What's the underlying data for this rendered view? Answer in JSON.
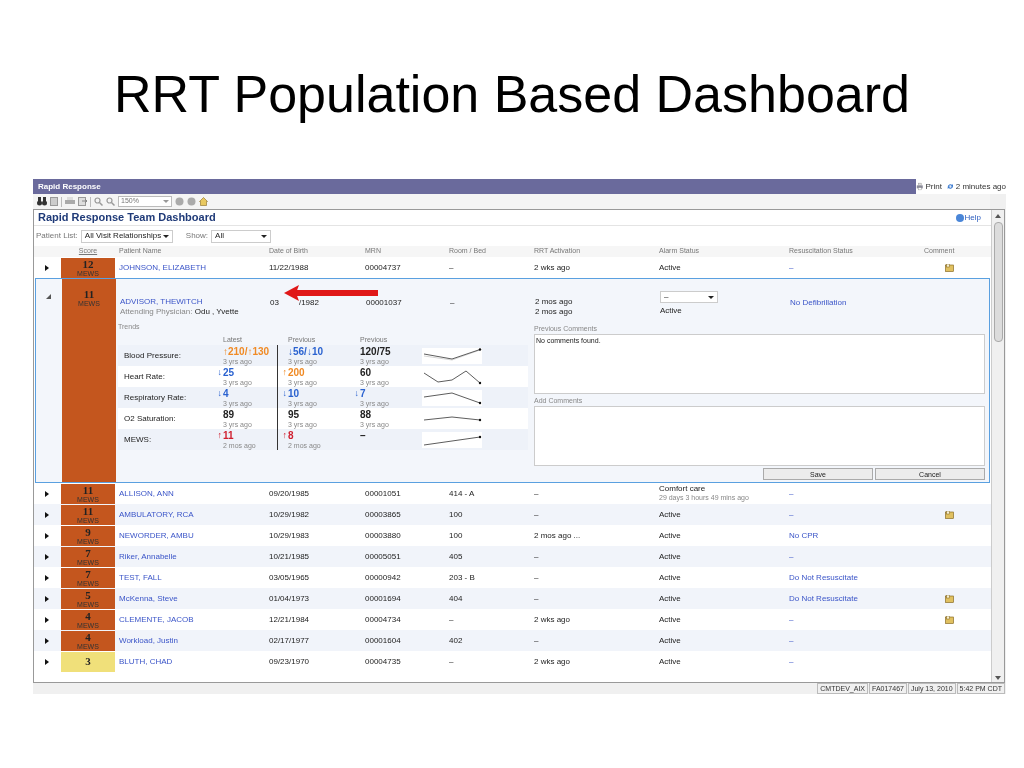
{
  "slide_title": "RRT Population Based Dashboard",
  "window": {
    "title": "Rapid Response",
    "print": "Print",
    "refreshed": "2 minutes ago"
  },
  "toolbar": {
    "zoom": "150%"
  },
  "dashboard": {
    "title": "Rapid Response Team Dashboard",
    "help": "Help"
  },
  "filters": [
    {
      "label": "Patient List:",
      "value": "All Visit Relationships"
    },
    {
      "label": "Show:",
      "value": "All"
    }
  ],
  "table": {
    "columns": [
      "Score",
      "Patient Name",
      "Date of Birth",
      "MRN",
      "Room / Bed",
      "RRT Activation",
      "Alarm Status",
      "Resuscitation Status",
      "Comment"
    ],
    "rows": [
      {
        "expanded": false,
        "score": "12",
        "score_label": "MEWS",
        "color": "#c4561e",
        "name": "JOHNSON, ELIZABETH",
        "dob": "11/22/1988",
        "mrn": "00004737",
        "room": "–",
        "rrt": [
          "2 wks ago"
        ],
        "alarm": "Active",
        "resuscitation": "–",
        "comment": true
      },
      {
        "expanded": true,
        "score": "11",
        "score_label": "MEWS",
        "color": "#c4561e",
        "name": "ADVISOR, THEWITCH",
        "physician_label": "Attending Physician:",
        "physician": "Odu , Yvette",
        "dob_visible": [
          "03",
          "/1982"
        ],
        "mrn": "00001037",
        "room": "–",
        "rrt": [
          "2 mos ago",
          "2 mos ago"
        ],
        "alarm_select": "–",
        "alarm": "Active",
        "resuscitation": "No Defibrillation"
      },
      {
        "expanded": false,
        "score": "11",
        "score_label": "MEWS",
        "color": "#c4561e",
        "name": "ALLISON, ANN",
        "dob": "09/20/1985",
        "mrn": "00001051",
        "room": "414 - A",
        "rrt": [
          "–"
        ],
        "alarm": "Comfort care",
        "alarm_detail": "29 days 3 hours 49 mins ago",
        "resuscitation": "–",
        "comment": false
      },
      {
        "expanded": false,
        "score": "11",
        "score_label": "MEWS",
        "color": "#c4561e",
        "name": "AMBULATORY, RCA",
        "dob": "10/29/1982",
        "mrn": "00003865",
        "room": "100",
        "rrt": [
          "–"
        ],
        "alarm": "Active",
        "resuscitation": "–",
        "comment": true
      },
      {
        "expanded": false,
        "score": "9",
        "score_label": "MEWS",
        "color": "#c4561e",
        "name": "NEWORDER, AMBU",
        "dob": "10/29/1983",
        "mrn": "00003880",
        "room": "100",
        "rrt": [
          "2 mos ago ..."
        ],
        "alarm": "Active",
        "resuscitation": "No CPR",
        "comment": false
      },
      {
        "expanded": false,
        "score": "7",
        "score_label": "MEWS",
        "color": "#c4561e",
        "name": "Riker, Annabelle",
        "dob": "10/21/1985",
        "mrn": "00005051",
        "room": "405",
        "rrt": [
          "–"
        ],
        "alarm": "Active",
        "resuscitation": "–",
        "comment": false
      },
      {
        "expanded": false,
        "score": "7",
        "score_label": "MEWS",
        "color": "#c4561e",
        "name": "TEST, FALL",
        "dob": "03/05/1965",
        "mrn": "00000942",
        "room": "203 - B",
        "rrt": [
          "–"
        ],
        "alarm": "Active",
        "resuscitation": "Do Not Resuscitate",
        "comment": false
      },
      {
        "expanded": false,
        "score": "5",
        "score_label": "MEWS",
        "color": "#c4561e",
        "name": "McKenna, Steve",
        "dob": "01/04/1973",
        "mrn": "00001694",
        "room": "404",
        "rrt": [
          "–"
        ],
        "alarm": "Active",
        "resuscitation": "Do Not Resuscitate",
        "comment": true
      },
      {
        "expanded": false,
        "score": "4",
        "score_label": "MEWS",
        "color": "#c4561e",
        "name": "CLEMENTE, JACOB",
        "dob": "12/21/1984",
        "mrn": "00004734",
        "room": "–",
        "rrt": [
          "2 wks ago"
        ],
        "alarm": "Active",
        "resuscitation": "–",
        "comment": true
      },
      {
        "expanded": false,
        "score": "4",
        "score_label": "MEWS",
        "color": "#c4561e",
        "name": "Workload, Justin",
        "dob": "02/17/1977",
        "mrn": "00001604",
        "room": "402",
        "rrt": [
          "–"
        ],
        "alarm": "Active",
        "resuscitation": "–",
        "comment": false
      },
      {
        "expanded": false,
        "score": "3",
        "color": "#f0e07a",
        "name": "BLUTH, CHAD",
        "dob": "09/23/1970",
        "mrn": "00004735",
        "room": "–",
        "rrt": [
          "2 wks ago"
        ],
        "alarm": "Active",
        "resuscitation": "–",
        "comment": false
      }
    ]
  },
  "details": {
    "trends_title": "Trends",
    "trend_columns": [
      "Latest",
      "Previous",
      "Previous"
    ],
    "trends": [
      {
        "label": "Blood Pressure:",
        "cells": [
          {
            "value": "↑210/↑130",
            "time": "3 yrs ago",
            "color": "#f08a24"
          },
          {
            "value": "↓56/↓10",
            "time": "3 yrs ago",
            "color": "#2a62d0"
          },
          {
            "value": "120/75",
            "time": "3 yrs ago",
            "color": "#222222"
          }
        ]
      },
      {
        "label": "Heart Rate:",
        "cells": [
          {
            "arrow": "↓",
            "value": "25",
            "time": "3 yrs ago",
            "color": "#2a62d0"
          },
          {
            "arrow": "↑",
            "value": "200",
            "time": "3 yrs ago",
            "color": "#f08a24"
          },
          {
            "value": "60",
            "time": "3 yrs ago",
            "color": "#222222"
          }
        ]
      },
      {
        "label": "Respiratory Rate:",
        "cells": [
          {
            "arrow": "↓",
            "value": "4",
            "time": "3 yrs ago",
            "color": "#2a62d0"
          },
          {
            "arrow": "↓",
            "value": "10",
            "time": "3 yrs ago",
            "color": "#2a62d0"
          },
          {
            "arrow": "↓",
            "value": "7",
            "time": "3 yrs ago",
            "color": "#2a62d0"
          }
        ]
      },
      {
        "label": "O2 Saturation:",
        "cells": [
          {
            "value": "89",
            "time": "3 yrs ago",
            "color": "#222222"
          },
          {
            "value": "95",
            "time": "3 yrs ago",
            "color": "#222222"
          },
          {
            "value": "88",
            "time": "3 yrs ago",
            "color": "#222222"
          }
        ]
      },
      {
        "label": "MEWS:",
        "cells": [
          {
            "arrow": "↑",
            "value": "11",
            "time": "2 mos ago",
            "color": "#d02030"
          },
          {
            "arrow": "↑",
            "value": "8",
            "time": "2 mos ago",
            "color": "#d02030"
          },
          {
            "value": "–",
            "color": "#222222"
          }
        ]
      }
    ],
    "previous_comments_label": "Previous Comments",
    "previous_comments": "No comments found.",
    "add_comments_label": "Add Comments",
    "buttons": [
      "Save",
      "Cancel"
    ]
  },
  "status_bar": [
    "CMTDEV_AIX",
    "FA017467",
    "July 13, 2010",
    "5:42 PM CDT"
  ]
}
